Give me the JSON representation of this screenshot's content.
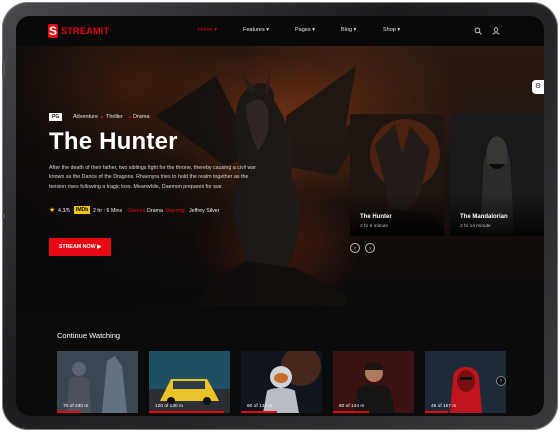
{
  "brand": {
    "logo_letter": "S",
    "name": "STREAMIT",
    "accent": "#e50914"
  },
  "nav": {
    "items": [
      {
        "label": "Home ▾",
        "active": true
      },
      {
        "label": "Features ▾",
        "active": false
      },
      {
        "label": "Pages ▾",
        "active": false
      },
      {
        "label": "Blog ▾",
        "active": false
      },
      {
        "label": "Shop ▾",
        "active": false
      }
    ],
    "icons": [
      "search-icon",
      "user-icon"
    ]
  },
  "hero": {
    "rating": "PG",
    "genres": [
      "Adventure",
      "Thriller",
      "Drama"
    ],
    "title": "The Hunter",
    "description": "After the death of their father, two siblings fight for the throne, thereby causing a civil war known as the Dance of the Dragons. Rhaenyra tries to hold the realm together as the tension rises following a tragic loss. Meanwhile, Daemon prepares for war.",
    "score": "4.3/5",
    "imdb": "IMDb",
    "duration": "2 hr : 6 Mins",
    "genres_label": "Genres:",
    "genres_value": "Drama",
    "starring_label": "Starring:",
    "starring_value": "Jeffrey Silver",
    "cta": "STREAM NOW ▶"
  },
  "featured_cards": [
    {
      "title": "The Hunter",
      "subtitle": "2 hr 6 minute"
    },
    {
      "title": "The Mandalorian",
      "subtitle": "2 hr 14 minute"
    }
  ],
  "continue_watching": {
    "title": "Continue Watching",
    "items": [
      {
        "label": "70 of 230 m",
        "progress": 0.3
      },
      {
        "label": "120 of 130 m",
        "progress": 0.92
      },
      {
        "label": "60 of 134 m",
        "progress": 0.45
      },
      {
        "label": "60 of 134 m",
        "progress": 0.45
      },
      {
        "label": "45 of 157 m",
        "progress": 0.29
      }
    ]
  }
}
